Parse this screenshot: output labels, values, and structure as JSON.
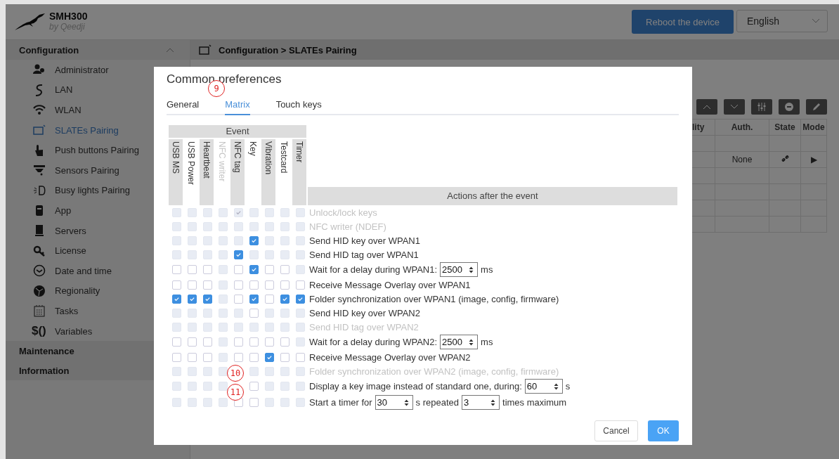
{
  "header": {
    "product": "SMH300",
    "vendor": "by Qeedji",
    "reboot_button": "Reboot the device",
    "language": "English"
  },
  "sidebar": {
    "sections": [
      {
        "title": "Configuration",
        "expanded": true,
        "items": [
          {
            "label": "Administrator",
            "selected": false
          },
          {
            "label": "LAN",
            "selected": false
          },
          {
            "label": "WLAN",
            "selected": false
          },
          {
            "label": "SLATEs Pairing",
            "selected": true
          },
          {
            "label": "Push buttons Pairing",
            "selected": false
          },
          {
            "label": "Sensors Pairing",
            "selected": false
          },
          {
            "label": "Busy lights Pairing",
            "selected": false
          },
          {
            "label": "App",
            "selected": false
          },
          {
            "label": "Servers",
            "selected": false
          },
          {
            "label": "License",
            "selected": false
          },
          {
            "label": "Date and time",
            "selected": false
          },
          {
            "label": "Regionality",
            "selected": false
          },
          {
            "label": "Tasks",
            "selected": false
          },
          {
            "label": "Variables",
            "selected": false,
            "icon_text": "$()"
          }
        ]
      },
      {
        "title": "Maintenance",
        "expanded": false
      },
      {
        "title": "Information",
        "expanded": false
      }
    ]
  },
  "breadcrumb": "Configuration > SLATEs Pairing",
  "table": {
    "columns": [
      "lity",
      "Auth.",
      "State",
      "Mode"
    ],
    "rows": [
      {
        "auth": "None",
        "mode": "▶"
      }
    ]
  },
  "dialog": {
    "title": "Common preferences",
    "tabs": [
      {
        "label": "General",
        "selected": false
      },
      {
        "label": "Matrix",
        "selected": true
      },
      {
        "label": "Touch keys",
        "selected": false
      }
    ],
    "event_header": "Event",
    "events": [
      {
        "label": "USB MS",
        "disabled": false
      },
      {
        "label": "USB Power",
        "disabled": false
      },
      {
        "label": "Heartbeat",
        "disabled": false
      },
      {
        "label": "NFC writer",
        "disabled": true
      },
      {
        "label": "NFC tag",
        "disabled": false
      },
      {
        "label": "Key",
        "disabled": false
      },
      {
        "label": "Vibration",
        "disabled": false
      },
      {
        "label": "Testcard",
        "disabled": false
      },
      {
        "label": "Timer",
        "disabled": false
      }
    ],
    "actions_header": "Actions after the event",
    "rows": [
      {
        "disabled": true,
        "parts": [
          {
            "kind": "text",
            "text": "Unlock/lock keys"
          }
        ],
        "cells": [
          {
            "checked": false,
            "disabled": true
          },
          {
            "checked": false,
            "disabled": true
          },
          {
            "checked": false,
            "disabled": true
          },
          {
            "checked": false,
            "disabled": true
          },
          {
            "checked": true,
            "disabled": true
          },
          {
            "checked": false,
            "disabled": true
          },
          {
            "checked": false,
            "disabled": true
          },
          {
            "checked": false,
            "disabled": true
          },
          {
            "checked": false,
            "disabled": true
          }
        ]
      },
      {
        "disabled": true,
        "parts": [
          {
            "kind": "text",
            "text": "NFC writer (NDEF)"
          }
        ],
        "cells": [
          {
            "checked": false,
            "disabled": true
          },
          {
            "checked": false,
            "disabled": true
          },
          {
            "checked": false,
            "disabled": true
          },
          {
            "checked": false,
            "disabled": true
          },
          {
            "checked": false,
            "disabled": true
          },
          {
            "checked": false,
            "disabled": true
          },
          {
            "checked": false,
            "disabled": true
          },
          {
            "checked": false,
            "disabled": true
          },
          {
            "checked": false,
            "disabled": true
          }
        ]
      },
      {
        "disabled": false,
        "parts": [
          {
            "kind": "text",
            "text": "Send HID key over WPAN1"
          }
        ],
        "cells": [
          {
            "checked": false,
            "disabled": true
          },
          {
            "checked": false,
            "disabled": true
          },
          {
            "checked": false,
            "disabled": true
          },
          {
            "checked": false,
            "disabled": true
          },
          {
            "checked": false,
            "disabled": true
          },
          {
            "checked": true,
            "disabled": false
          },
          {
            "checked": false,
            "disabled": true
          },
          {
            "checked": false,
            "disabled": true
          },
          {
            "checked": false,
            "disabled": true
          }
        ]
      },
      {
        "disabled": false,
        "parts": [
          {
            "kind": "text",
            "text": "Send HID tag over WPAN1"
          }
        ],
        "cells": [
          {
            "checked": false,
            "disabled": true
          },
          {
            "checked": false,
            "disabled": true
          },
          {
            "checked": false,
            "disabled": true
          },
          {
            "checked": false,
            "disabled": true
          },
          {
            "checked": true,
            "disabled": false
          },
          {
            "checked": false,
            "disabled": true
          },
          {
            "checked": false,
            "disabled": true
          },
          {
            "checked": false,
            "disabled": true
          },
          {
            "checked": false,
            "disabled": true
          }
        ]
      },
      {
        "disabled": false,
        "parts": [
          {
            "kind": "text",
            "text": "Wait for a delay during WPAN1:"
          },
          {
            "kind": "spin",
            "value": "2500"
          },
          {
            "kind": "text",
            "text": "ms"
          }
        ],
        "cells": [
          {
            "checked": false,
            "disabled": false
          },
          {
            "checked": false,
            "disabled": false
          },
          {
            "checked": false,
            "disabled": false
          },
          {
            "checked": false,
            "disabled": true
          },
          {
            "checked": false,
            "disabled": false
          },
          {
            "checked": true,
            "disabled": false
          },
          {
            "checked": false,
            "disabled": false
          },
          {
            "checked": false,
            "disabled": false
          },
          {
            "checked": false,
            "disabled": true
          }
        ]
      },
      {
        "disabled": false,
        "parts": [
          {
            "kind": "text",
            "text": "Receive Message Overlay over WPAN1"
          }
        ],
        "cells": [
          {
            "checked": false,
            "disabled": false
          },
          {
            "checked": false,
            "disabled": false
          },
          {
            "checked": false,
            "disabled": false
          },
          {
            "checked": false,
            "disabled": true
          },
          {
            "checked": false,
            "disabled": false
          },
          {
            "checked": false,
            "disabled": false
          },
          {
            "checked": false,
            "disabled": false
          },
          {
            "checked": false,
            "disabled": false
          },
          {
            "checked": false,
            "disabled": false
          }
        ]
      },
      {
        "disabled": false,
        "parts": [
          {
            "kind": "text",
            "text": "Folder synchronization over WPAN1 (image, config, firmware)"
          }
        ],
        "cells": [
          {
            "checked": true,
            "disabled": false
          },
          {
            "checked": true,
            "disabled": false
          },
          {
            "checked": true,
            "disabled": false
          },
          {
            "checked": false,
            "disabled": true
          },
          {
            "checked": false,
            "disabled": false
          },
          {
            "checked": true,
            "disabled": false
          },
          {
            "checked": false,
            "disabled": false
          },
          {
            "checked": true,
            "disabled": false
          },
          {
            "checked": true,
            "disabled": false
          }
        ]
      },
      {
        "disabled": false,
        "parts": [
          {
            "kind": "text",
            "text": "Send HID key over WPAN2"
          }
        ],
        "cells": [
          {
            "checked": false,
            "disabled": true
          },
          {
            "checked": false,
            "disabled": true
          },
          {
            "checked": false,
            "disabled": true
          },
          {
            "checked": false,
            "disabled": true
          },
          {
            "checked": false,
            "disabled": true
          },
          {
            "checked": false,
            "disabled": false
          },
          {
            "checked": false,
            "disabled": true
          },
          {
            "checked": false,
            "disabled": true
          },
          {
            "checked": false,
            "disabled": true
          }
        ]
      },
      {
        "disabled": true,
        "parts": [
          {
            "kind": "text",
            "text": "Send HID tag over WPAN2"
          }
        ],
        "cells": [
          {
            "checked": false,
            "disabled": true
          },
          {
            "checked": false,
            "disabled": true
          },
          {
            "checked": false,
            "disabled": true
          },
          {
            "checked": false,
            "disabled": true
          },
          {
            "checked": false,
            "disabled": true
          },
          {
            "checked": false,
            "disabled": true
          },
          {
            "checked": false,
            "disabled": true
          },
          {
            "checked": false,
            "disabled": true
          },
          {
            "checked": false,
            "disabled": true
          }
        ]
      },
      {
        "disabled": false,
        "parts": [
          {
            "kind": "text",
            "text": "Wait for a delay during WPAN2:"
          },
          {
            "kind": "spin",
            "value": "2500"
          },
          {
            "kind": "text",
            "text": "ms"
          }
        ],
        "cells": [
          {
            "checked": false,
            "disabled": false
          },
          {
            "checked": false,
            "disabled": false
          },
          {
            "checked": false,
            "disabled": false
          },
          {
            "checked": false,
            "disabled": true
          },
          {
            "checked": false,
            "disabled": false
          },
          {
            "checked": false,
            "disabled": false
          },
          {
            "checked": false,
            "disabled": false
          },
          {
            "checked": false,
            "disabled": false
          },
          {
            "checked": false,
            "disabled": true
          }
        ]
      },
      {
        "disabled": false,
        "parts": [
          {
            "kind": "text",
            "text": "Receive Message Overlay over WPAN2"
          }
        ],
        "cells": [
          {
            "checked": false,
            "disabled": false
          },
          {
            "checked": false,
            "disabled": false
          },
          {
            "checked": false,
            "disabled": false
          },
          {
            "checked": false,
            "disabled": true
          },
          {
            "checked": false,
            "disabled": false
          },
          {
            "checked": false,
            "disabled": false
          },
          {
            "checked": true,
            "disabled": false
          },
          {
            "checked": false,
            "disabled": false
          },
          {
            "checked": false,
            "disabled": false
          }
        ]
      },
      {
        "disabled": true,
        "parts": [
          {
            "kind": "text",
            "text": "Folder synchronization over WPAN2 (image, config, firmware)"
          }
        ],
        "cells": [
          {
            "checked": false,
            "disabled": true
          },
          {
            "checked": false,
            "disabled": true
          },
          {
            "checked": false,
            "disabled": true
          },
          {
            "checked": false,
            "disabled": true
          },
          {
            "kind": "covered"
          },
          {
            "checked": false,
            "disabled": true
          },
          {
            "checked": false,
            "disabled": true
          },
          {
            "checked": false,
            "disabled": true
          },
          {
            "checked": false,
            "disabled": true
          }
        ]
      },
      {
        "disabled": false,
        "parts": [
          {
            "kind": "text",
            "text": "Display a key image instead of standard one, during:"
          },
          {
            "kind": "spin",
            "value": "60"
          },
          {
            "kind": "text",
            "text": "s"
          }
        ],
        "cells": [
          {
            "checked": false,
            "disabled": true
          },
          {
            "checked": false,
            "disabled": true
          },
          {
            "checked": false,
            "disabled": true
          },
          {
            "checked": false,
            "disabled": true
          },
          {
            "kind": "covered"
          },
          {
            "checked": false,
            "disabled": false
          },
          {
            "checked": false,
            "disabled": true
          },
          {
            "checked": false,
            "disabled": true
          },
          {
            "checked": false,
            "disabled": true
          }
        ]
      },
      {
        "disabled": false,
        "parts": [
          {
            "kind": "text",
            "text": "Start a timer for"
          },
          {
            "kind": "spin",
            "value": "30"
          },
          {
            "kind": "text",
            "text": "s repeated"
          },
          {
            "kind": "spin",
            "value": "3"
          },
          {
            "kind": "text",
            "text": "times maximum"
          }
        ],
        "cells": [
          {
            "checked": false,
            "disabled": true
          },
          {
            "checked": false,
            "disabled": true
          },
          {
            "checked": false,
            "disabled": true
          },
          {
            "checked": false,
            "disabled": true
          },
          {
            "checked": false,
            "disabled": false
          },
          {
            "checked": false,
            "disabled": false
          },
          {
            "checked": false,
            "disabled": true
          },
          {
            "checked": false,
            "disabled": true
          },
          {
            "checked": false,
            "disabled": true
          }
        ]
      }
    ],
    "buttons": [
      {
        "label": "Cancel",
        "kind": "secondary"
      },
      {
        "label": "OK",
        "kind": "primary"
      }
    ],
    "callouts": [
      "9",
      "10",
      "11"
    ]
  }
}
